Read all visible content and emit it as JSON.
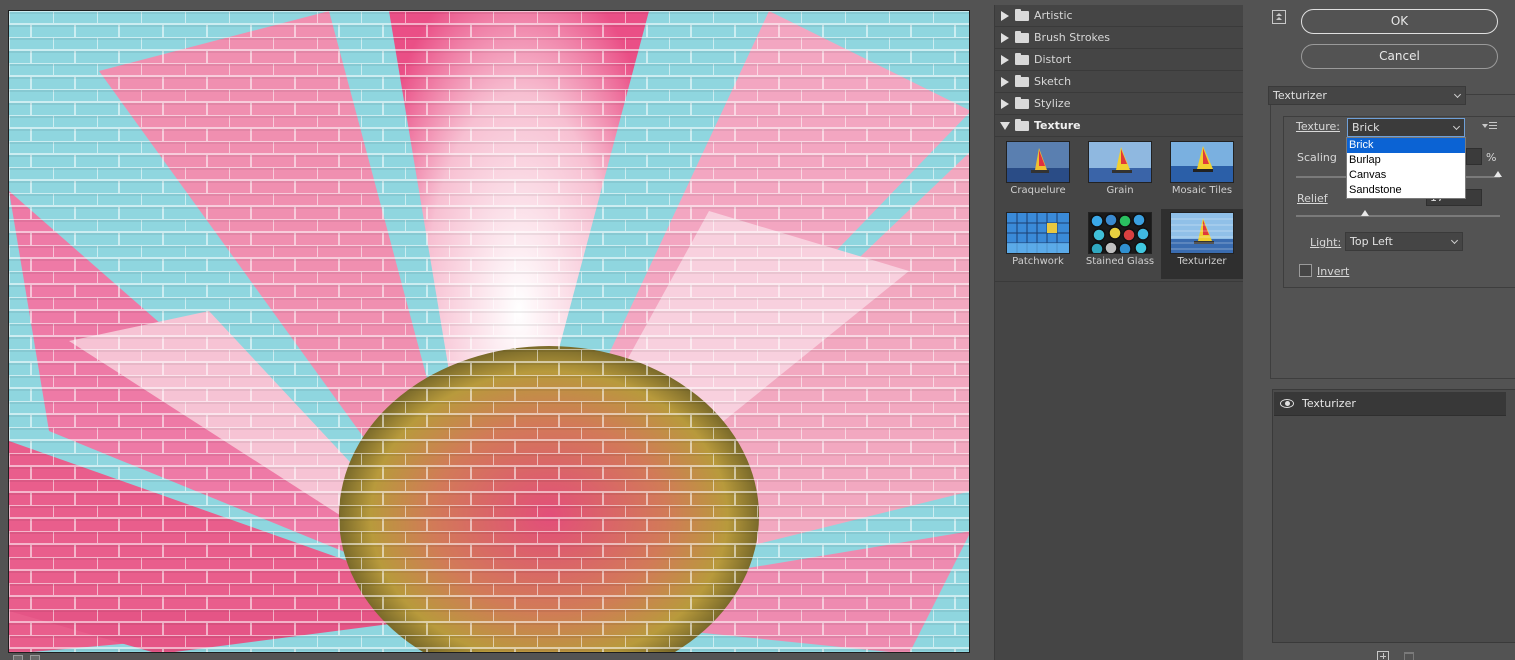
{
  "gallery": {
    "categories": [
      {
        "label": "Artistic",
        "open": false
      },
      {
        "label": "Brush Strokes",
        "open": false
      },
      {
        "label": "Distort",
        "open": false
      },
      {
        "label": "Sketch",
        "open": false
      },
      {
        "label": "Stylize",
        "open": false
      },
      {
        "label": "Texture",
        "open": true
      }
    ],
    "thumbnails": [
      {
        "label": "Craquelure"
      },
      {
        "label": "Grain"
      },
      {
        "label": "Mosaic Tiles"
      },
      {
        "label": "Patchwork"
      },
      {
        "label": "Stained Glass"
      },
      {
        "label": "Texturizer",
        "selected": true
      }
    ]
  },
  "buttons": {
    "ok_label": "OK",
    "cancel_label": "Cancel"
  },
  "settings": {
    "filter_selected": "Texturizer",
    "texture_label": "Texture:",
    "texture_selected": "Brick",
    "texture_options": [
      "Brick",
      "Burlap",
      "Canvas",
      "Sandstone"
    ],
    "scaling_label": "Scaling",
    "scaling_unit": "%",
    "relief_label": "Relief",
    "relief_value": "17",
    "light_label": "Light:",
    "light_selected": "Top Left",
    "invert_label": "Invert",
    "invert_checked": false
  },
  "layers": {
    "items": [
      {
        "name": "Texturizer",
        "visible": true
      }
    ]
  }
}
